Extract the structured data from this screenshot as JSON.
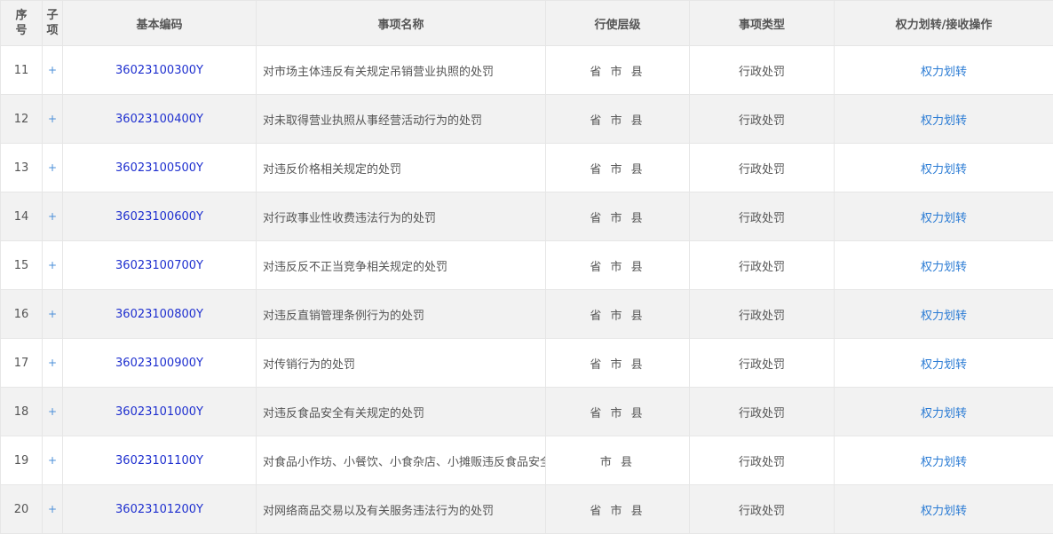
{
  "header": {
    "seq": "序号",
    "sub": "子项",
    "code": "基本编码",
    "name": "事项名称",
    "level": "行使层级",
    "type": "事项类型",
    "op": "权力划转/接收操作"
  },
  "rows": [
    {
      "seq": "11",
      "expand": "+",
      "code": "36023100300Y",
      "name": "对市场主体违反有关规定吊销营业执照的处罚",
      "level": "省 市 县",
      "type": "行政处罚",
      "op": "权力划转"
    },
    {
      "seq": "12",
      "expand": "+",
      "code": "36023100400Y",
      "name": "对未取得营业执照从事经营活动行为的处罚",
      "level": "省 市 县",
      "type": "行政处罚",
      "op": "权力划转"
    },
    {
      "seq": "13",
      "expand": "+",
      "code": "36023100500Y",
      "name": "对违反价格相关规定的处罚",
      "level": "省 市 县",
      "type": "行政处罚",
      "op": "权力划转"
    },
    {
      "seq": "14",
      "expand": "+",
      "code": "36023100600Y",
      "name": "对行政事业性收费违法行为的处罚",
      "level": "省 市 县",
      "type": "行政处罚",
      "op": "权力划转"
    },
    {
      "seq": "15",
      "expand": "+",
      "code": "36023100700Y",
      "name": "对违反反不正当竞争相关规定的处罚",
      "level": "省 市 县",
      "type": "行政处罚",
      "op": "权力划转"
    },
    {
      "seq": "16",
      "expand": "+",
      "code": "36023100800Y",
      "name": "对违反直销管理条例行为的处罚",
      "level": "省 市 县",
      "type": "行政处罚",
      "op": "权力划转"
    },
    {
      "seq": "17",
      "expand": "+",
      "code": "36023100900Y",
      "name": "对传销行为的处罚",
      "level": "省 市 县",
      "type": "行政处罚",
      "op": "权力划转"
    },
    {
      "seq": "18",
      "expand": "+",
      "code": "36023101000Y",
      "name": "对违反食品安全有关规定的处罚",
      "level": "省 市 县",
      "type": "行政处罚",
      "op": "权力划转"
    },
    {
      "seq": "19",
      "expand": "+",
      "code": "36023101100Y",
      "name": "对食品小作坊、小餐饮、小食杂店、小摊贩违反食品安全有",
      "level": "市 县",
      "type": "行政处罚",
      "op": "权力划转"
    },
    {
      "seq": "20",
      "expand": "+",
      "code": "36023101200Y",
      "name": "对网络商品交易以及有关服务违法行为的处罚",
      "level": "省 市 县",
      "type": "行政处罚",
      "op": "权力划转"
    }
  ]
}
